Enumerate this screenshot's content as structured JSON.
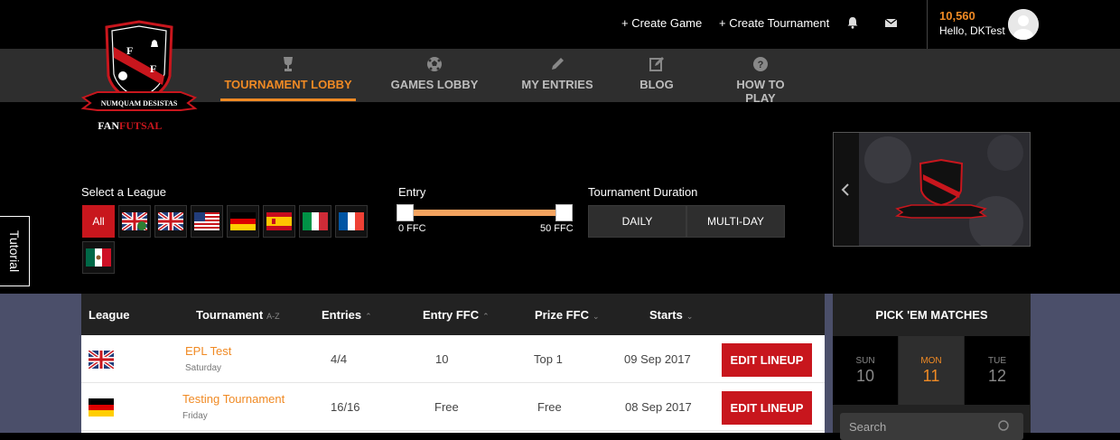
{
  "header": {
    "create_game": "+ Create Game",
    "create_tournament": "+ Create Tournament",
    "balance": "10,560",
    "greeting": "Hello, DKTest"
  },
  "logo": {
    "motto": "NUMQUAM DESISTAS",
    "brand_a": "FAN",
    "brand_b": "FUTSAL",
    "letter": "F"
  },
  "nav": {
    "items": [
      {
        "label": "TOURNAMENT LOBBY",
        "icon": "trophy-icon",
        "active": true
      },
      {
        "label": "GAMES LOBBY",
        "icon": "soccer-ball-icon",
        "active": false
      },
      {
        "label": "MY ENTRIES",
        "icon": "pencil-icon",
        "active": false
      },
      {
        "label": "BLOG",
        "icon": "edit-icon",
        "active": false
      },
      {
        "label": "HOW TO PLAY",
        "icon": "question-icon",
        "active": false
      }
    ]
  },
  "tutorial": {
    "label": "Tutorial"
  },
  "filters": {
    "league_label": "Select a League",
    "all_label": "All",
    "leagues": [
      "uk-flag",
      "england-flag",
      "usa-flag",
      "germany-flag",
      "spain-flag",
      "italy-flag",
      "france-flag",
      "mexico-flag"
    ],
    "entry_label": "Entry",
    "entry_min": "0 FFC",
    "entry_max": "50 FFC",
    "duration_label": "Tournament Duration",
    "daily": "DAILY",
    "multiday": "MULTI-DAY"
  },
  "table": {
    "headers": {
      "league": "League",
      "tournament": "Tournament",
      "tournament_sort": "A-Z",
      "entries": "Entries",
      "entry_ffc": "Entry FFC",
      "prize_ffc": "Prize FFC",
      "starts": "Starts"
    },
    "rows": [
      {
        "flag": "uk-flag",
        "name": "EPL Test",
        "day": "Saturday",
        "entries": "4/4",
        "entry_ffc": "10",
        "prize": "Top 1",
        "starts": "09 Sep 2017",
        "action": "EDIT LINEUP"
      },
      {
        "flag": "germany-flag",
        "name": "Testing Tournament",
        "day": "Friday",
        "entries": "16/16",
        "entry_ffc": "Free",
        "prize": "Free",
        "starts": "08 Sep 2017",
        "action": "EDIT LINEUP"
      }
    ]
  },
  "pickem": {
    "title": "PICK 'EM MATCHES",
    "days": [
      {
        "dow": "SUN",
        "num": "10",
        "selected": false
      },
      {
        "dow": "MON",
        "num": "11",
        "selected": true
      },
      {
        "dow": "TUE",
        "num": "12",
        "selected": false
      }
    ],
    "search_placeholder": "Search"
  },
  "colors": {
    "accent": "#f08a24",
    "danger": "#c8161d",
    "nav_bg": "#2e2e2e"
  }
}
